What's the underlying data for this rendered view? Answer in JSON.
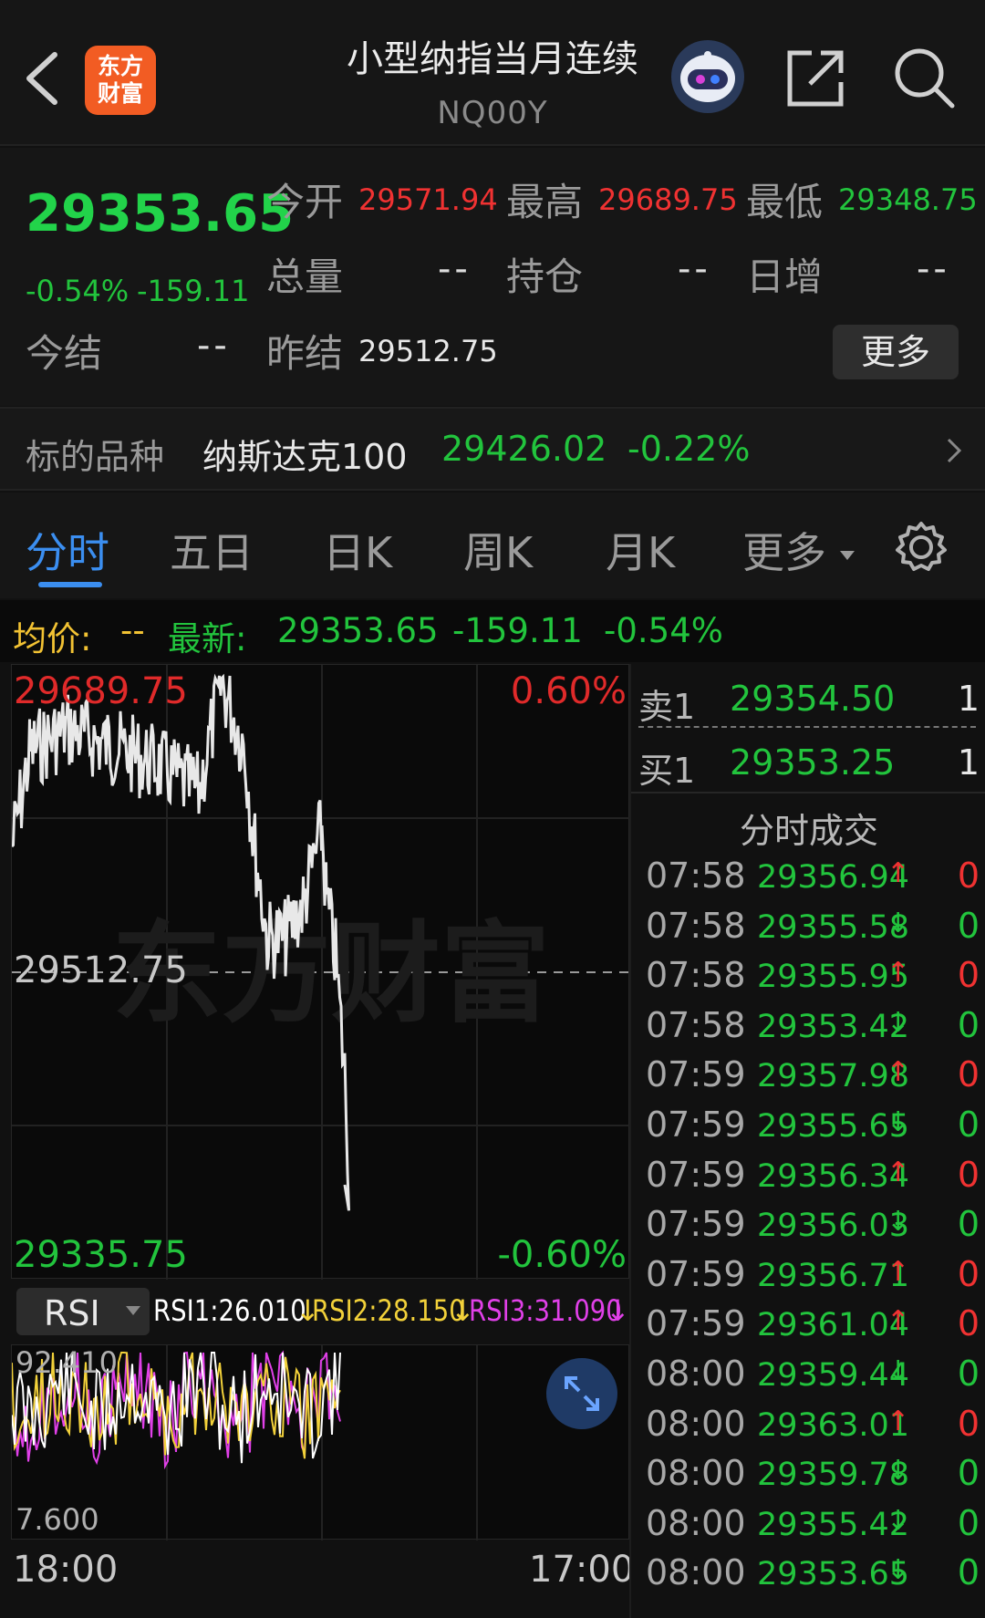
{
  "header": {
    "logo_line1": "东方",
    "logo_line2": "财富",
    "title": "小型纳指当月连续",
    "subtitle": "NQ00Y"
  },
  "quote": {
    "last": "29353.65",
    "change_pct": "-0.54%",
    "change": "-159.11",
    "open_label": "今开",
    "open": "29571.94",
    "high_label": "最高",
    "high": "29689.75",
    "low_label": "最低",
    "low": "29348.75",
    "volume_label": "总量",
    "volume": "--",
    "oi_label": "持仓",
    "oi": "--",
    "daily_inc_label": "日增",
    "daily_inc": "--",
    "settle_label": "今结",
    "settle": "--",
    "prev_settle_label": "昨结",
    "prev_settle": "29512.75",
    "more_label": "更多"
  },
  "underlying": {
    "label": "标的品种",
    "name": "纳斯达克100",
    "price": "29426.02",
    "change_pct": "-0.22%"
  },
  "tabs": [
    "分时",
    "五日",
    "日K",
    "周K",
    "月K",
    "更多"
  ],
  "infobar": {
    "avg_label": "均价:",
    "avg_value": "--",
    "latest_label": "最新:",
    "latest": "29353.65",
    "change": "-159.11",
    "change_pct": "-0.54%"
  },
  "chart": {
    "max_label": "29689.75",
    "max_pct": "0.60%",
    "mid_label": "29512.75",
    "min_label": "29335.75",
    "min_pct": "-0.60%",
    "time_start": "18:00",
    "time_end": "17:00",
    "watermark": "东方财富",
    "line_color": "#e8e8e8",
    "ref_color": "#9a9a9a"
  },
  "rsi": {
    "selector": "RSI",
    "rsi1": "RSI1:26.010",
    "rsi2": "RSI2:28.150",
    "rsi3": "RSI3:31.090",
    "max_label": "92.410",
    "min_label": "7.600",
    "rsi1_color": "#ffffff",
    "rsi2_color": "#f2d13a",
    "rsi3_color": "#e040e8"
  },
  "orderbook": {
    "ask_label": "卖1",
    "ask_price": "29354.50",
    "ask_vol": "1",
    "bid_label": "买1",
    "bid_price": "29353.25",
    "bid_vol": "1"
  },
  "ticks_title": "分时成交",
  "ticks": [
    {
      "time": "07:58",
      "price": "29356.94",
      "dir": "up",
      "vol": "0"
    },
    {
      "time": "07:58",
      "price": "29355.58",
      "dir": "down",
      "vol": "0"
    },
    {
      "time": "07:58",
      "price": "29355.95",
      "dir": "up",
      "vol": "0"
    },
    {
      "time": "07:58",
      "price": "29353.42",
      "dir": "down",
      "vol": "0"
    },
    {
      "time": "07:59",
      "price": "29357.98",
      "dir": "up",
      "vol": "0"
    },
    {
      "time": "07:59",
      "price": "29355.65",
      "dir": "down",
      "vol": "0"
    },
    {
      "time": "07:59",
      "price": "29356.34",
      "dir": "up",
      "vol": "0"
    },
    {
      "time": "07:59",
      "price": "29356.03",
      "dir": "down",
      "vol": "0"
    },
    {
      "time": "07:59",
      "price": "29356.71",
      "dir": "up",
      "vol": "0"
    },
    {
      "time": "07:59",
      "price": "29361.04",
      "dir": "up",
      "vol": "0"
    },
    {
      "time": "08:00",
      "price": "29359.44",
      "dir": "down",
      "vol": "0"
    },
    {
      "time": "08:00",
      "price": "29363.01",
      "dir": "up",
      "vol": "0"
    },
    {
      "time": "08:00",
      "price": "29359.78",
      "dir": "down",
      "vol": "0"
    },
    {
      "time": "08:00",
      "price": "29355.42",
      "dir": "down",
      "vol": "0"
    },
    {
      "time": "08:00",
      "price": "29353.65",
      "dir": "down",
      "vol": "0"
    }
  ],
  "icons": {
    "back": "chevron-left-icon",
    "ai": "robot-assistant-icon",
    "share": "share-icon",
    "search": "search-icon",
    "settings": "gear-icon",
    "expand": "expand-icon",
    "arrow": "chevron-right-icon",
    "dropdown": "caret-down-icon"
  },
  "colors": {
    "up": "#f03232",
    "down": "#22c43d",
    "accent": "#3b8ef0"
  }
}
